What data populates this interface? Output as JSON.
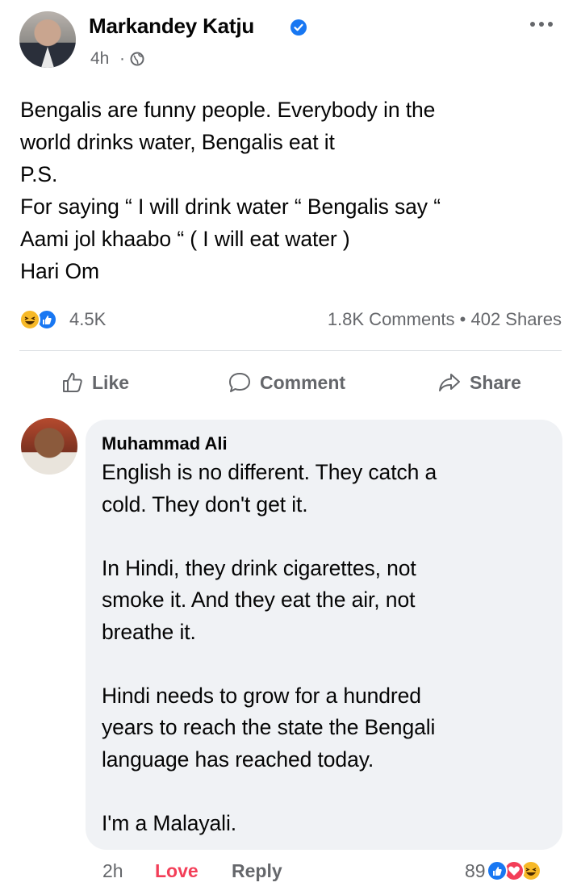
{
  "post": {
    "author": "Markandey Katju",
    "time": "4h",
    "separator": "·",
    "text_lines": [
      "Bengalis are funny people. Everybody in the",
      "world drinks water, Bengalis eat it",
      "P.S.",
      "For saying “ I will drink water “ Bengalis say “",
      "Aami jol khaabo “ ( I will eat water )",
      "Hari Om"
    ],
    "reaction_count": "4.5K",
    "comments_shares": "1.8K Comments • 402 Shares"
  },
  "actions": {
    "like": "Like",
    "comment": "Comment",
    "share": "Share"
  },
  "comment": {
    "author": "Muhammad Ali",
    "text_lines": [
      "English is no different. They catch a",
      "cold. They don't get it.",
      "",
      "In Hindi, they drink cigarettes, not",
      "smoke it. And they eat the air, not",
      "breathe it.",
      "",
      "Hindi needs to grow for a hundred",
      "years to reach the state the Bengali",
      "language has reached today.",
      "",
      "I'm a Malayali."
    ],
    "time": "2h",
    "love_label": "Love",
    "reply_label": "Reply",
    "reaction_count": "89"
  },
  "colors": {
    "facebook_blue": "#1877f2",
    "love_red": "#f33e58",
    "haha_yellow": "#f7b928",
    "meta_gray": "#65676b",
    "bubble_bg": "#f0f2f5"
  },
  "icons": [
    "verified-badge-icon",
    "globe-icon",
    "more-options-icon",
    "haha-reaction-icon",
    "like-reaction-icon",
    "love-reaction-icon",
    "thumbs-up-icon",
    "comment-icon",
    "share-icon"
  ]
}
